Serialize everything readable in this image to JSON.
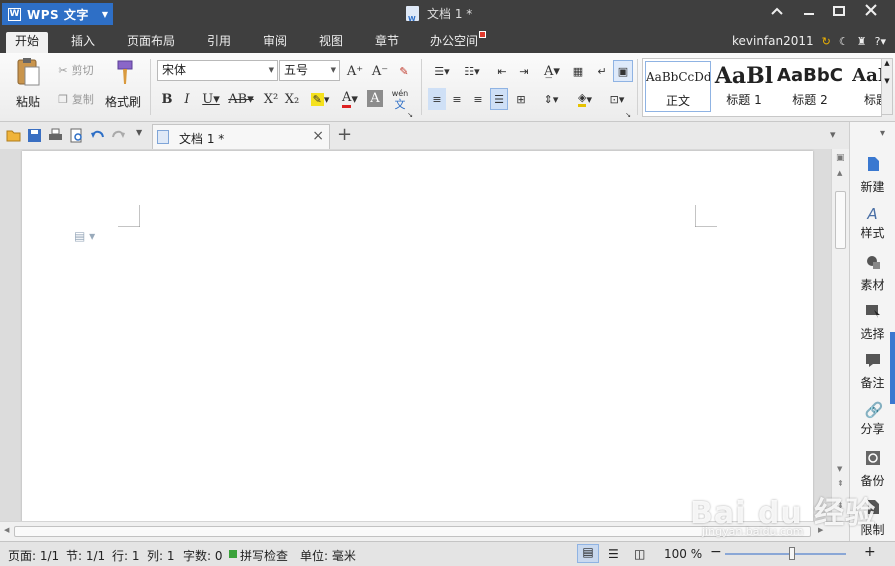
{
  "colors": {
    "accent": "#2e6fc6",
    "titlebar": "#3f3f3f",
    "ribbon": "#f1f1f1",
    "status_green": "#3aa23a"
  },
  "app": {
    "name": "WPS 文字",
    "document_title": "文档 1 *"
  },
  "menu_tabs": [
    {
      "label": "开始",
      "active": true
    },
    {
      "label": "插入"
    },
    {
      "label": "页面布局"
    },
    {
      "label": "引用"
    },
    {
      "label": "审阅"
    },
    {
      "label": "视图"
    },
    {
      "label": "章节"
    },
    {
      "label": "办公空间",
      "notification": true
    }
  ],
  "user": {
    "name": "kevinfan2011"
  },
  "ribbon": {
    "paste_label": "粘贴",
    "cut_label": "剪切",
    "copy_label": "复制",
    "format_painter_label": "格式刷",
    "font_name": "宋体",
    "font_size": "五号",
    "phonetic_top": "wén",
    "phonetic_bottom": "文",
    "styles": [
      {
        "sample": "AaBbCcDd",
        "label": "正文",
        "selected": true
      },
      {
        "sample": "AaBl",
        "label": "标题 1"
      },
      {
        "sample": "AaBbC",
        "label": "标题 2"
      },
      {
        "sample": "AaBl",
        "label": "标题"
      }
    ]
  },
  "doc_tab": {
    "name": "文档 1 *"
  },
  "task_pane": [
    {
      "label": "新建",
      "icon": "new-doc-icon"
    },
    {
      "label": "样式",
      "icon": "style-icon"
    },
    {
      "label": "素材",
      "icon": "material-icon"
    },
    {
      "label": "选择",
      "icon": "select-icon"
    },
    {
      "label": "备注",
      "icon": "note-icon"
    },
    {
      "label": "分享",
      "icon": "share-icon"
    },
    {
      "label": "备份",
      "icon": "backup-icon"
    },
    {
      "label": "限制",
      "icon": "restrict-icon"
    }
  ],
  "status": {
    "page": "页面: 1/1",
    "section": "节: 1/1",
    "row": "行: 1",
    "col": "列: 1",
    "word_count": "字数: 0",
    "spell_check": "拼写检查",
    "unit": "单位: 毫米",
    "zoom": "100 %"
  },
  "watermark": {
    "main": "Bai du 经验",
    "sub": "jingyan.baidu.com"
  }
}
